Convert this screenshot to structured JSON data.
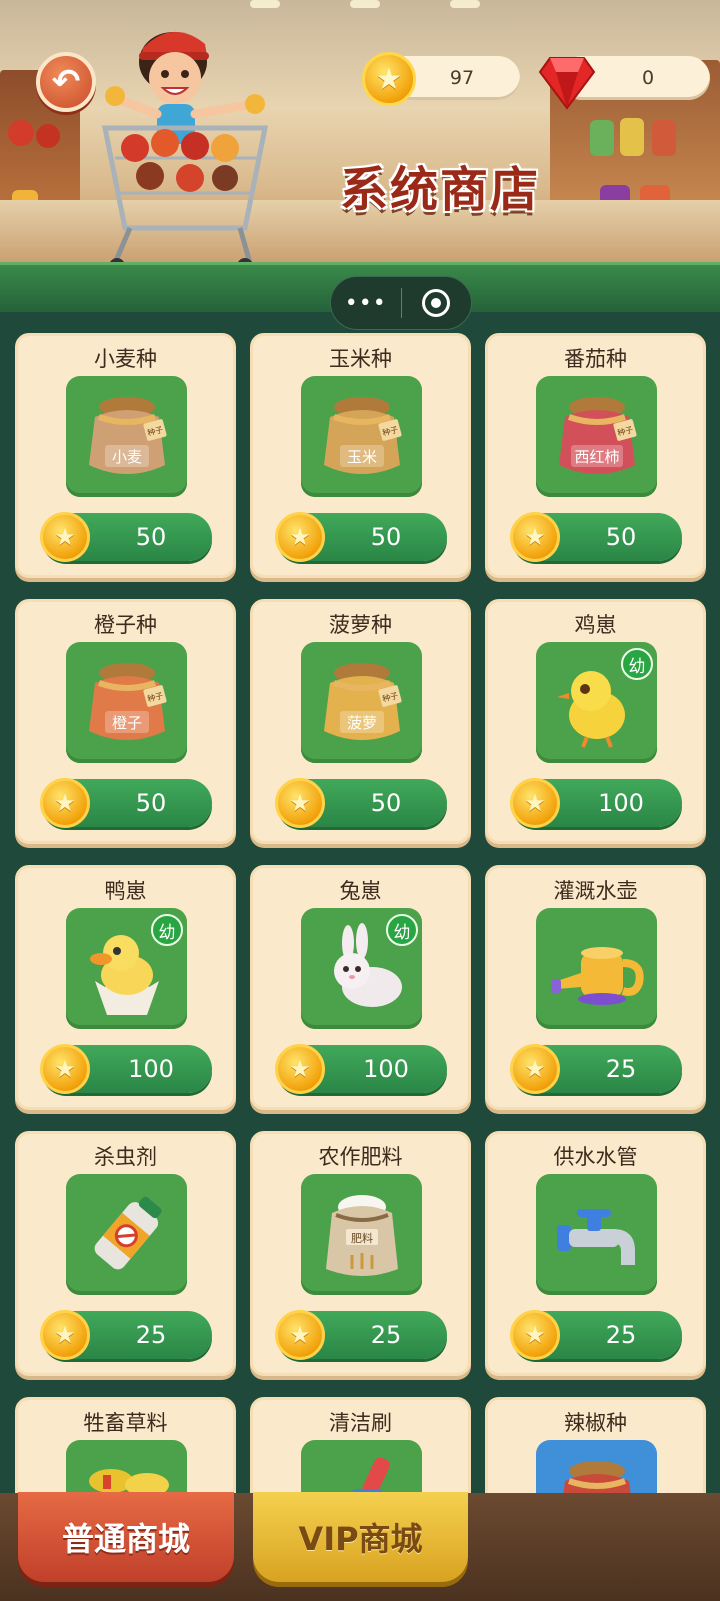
{
  "header": {
    "title": "系统商店",
    "back_icon": "back-arrow-icon",
    "gold": {
      "icon": "gold-coin-icon",
      "value": "97"
    },
    "gems": {
      "icon": "red-gem-icon",
      "value": "0"
    }
  },
  "capsule": {
    "more_icon": "more-dots-icon",
    "close_icon": "target-icon"
  },
  "items": [
    {
      "name": "小麦种",
      "icon": "wheat-seed-bag-icon",
      "bag_label": "小麦",
      "price": "50"
    },
    {
      "name": "玉米种",
      "icon": "corn-seed-bag-icon",
      "bag_label": "玉米",
      "price": "50"
    },
    {
      "name": "番茄种",
      "icon": "tomato-seed-bag-icon",
      "bag_label": "西红柿",
      "price": "50"
    },
    {
      "name": "橙子种",
      "icon": "orange-seed-bag-icon",
      "bag_label": "橙子",
      "price": "50"
    },
    {
      "name": "菠萝种",
      "icon": "pineapple-seed-bag-icon",
      "bag_label": "菠萝",
      "price": "50"
    },
    {
      "name": "鸡崽",
      "icon": "chick-icon",
      "badge": "幼",
      "price": "100"
    },
    {
      "name": "鸭崽",
      "icon": "duckling-icon",
      "badge": "幼",
      "price": "100"
    },
    {
      "name": "兔崽",
      "icon": "bunny-icon",
      "badge": "幼",
      "price": "100"
    },
    {
      "name": "灌溉水壶",
      "icon": "watering-can-icon",
      "price": "25"
    },
    {
      "name": "杀虫剂",
      "icon": "pesticide-can-icon",
      "price": "25"
    },
    {
      "name": "农作肥料",
      "icon": "fertilizer-sack-icon",
      "bag_label": "肥料",
      "price": "25"
    },
    {
      "name": "供水水管",
      "icon": "water-tap-icon",
      "price": "25"
    },
    {
      "name": "牲畜草料",
      "icon": "hay-fodder-icon"
    },
    {
      "name": "清洁刷",
      "icon": "cleaning-brush-icon"
    },
    {
      "name": "辣椒种",
      "icon": "chili-seed-bag-icon"
    }
  ],
  "bottom_nav": {
    "normal_label": "普通商城",
    "vip_label": "VIP商城"
  },
  "seed_tag": "种子"
}
